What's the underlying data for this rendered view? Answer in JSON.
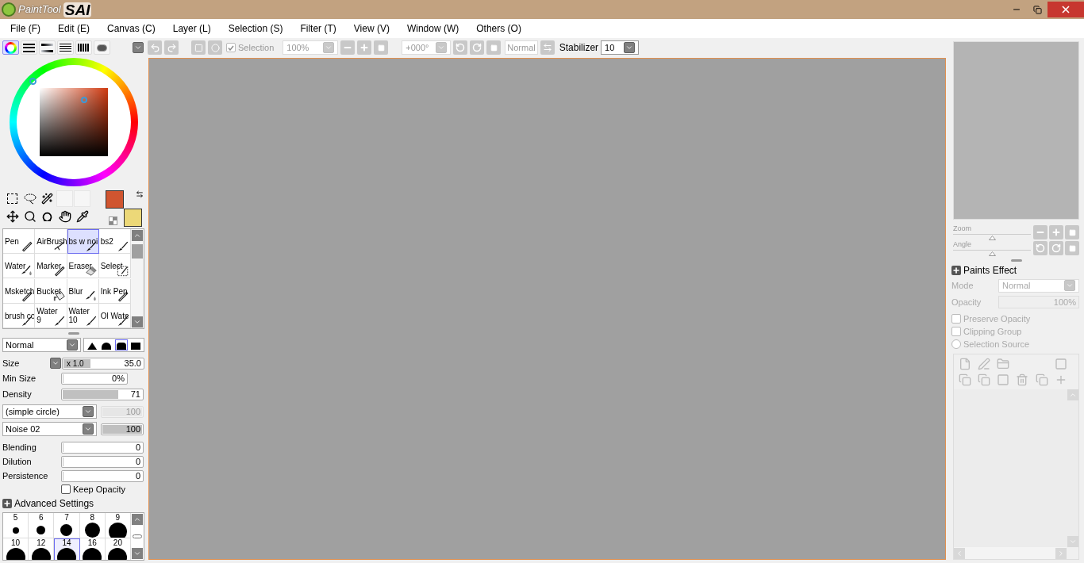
{
  "title_bar": {
    "logo_small": "PaintTool",
    "logo_large": "SAI"
  },
  "menu": [
    "File (F)",
    "Edit (E)",
    "Canvas (C)",
    "Layer (L)",
    "Selection (S)",
    "Filter (T)",
    "View (V)",
    "Window (W)",
    "Others (O)"
  ],
  "color_tabs": [
    {
      "kind": "wheel",
      "selected": true
    },
    {
      "kind": "rgb",
      "selected": false
    },
    {
      "kind": "hsv",
      "selected": false
    },
    {
      "kind": "palette",
      "selected": false
    },
    {
      "kind": "grid",
      "selected": false
    },
    {
      "kind": "scratch",
      "selected": false
    }
  ],
  "toolbar": {
    "selection": {
      "label": "Selection",
      "checked": true
    },
    "zoom": "100%",
    "angle": "+000°",
    "blend": "Normal",
    "stabilizer_label": "Stabilizer",
    "stabilizer": "10"
  },
  "tools": [
    {
      "label": "Pen",
      "kind": "pen",
      "selected": false
    },
    {
      "label": "AirBrush",
      "kind": "airbrush",
      "selected": false
    },
    {
      "label": "bs w noi",
      "kind": "brush",
      "selected": true
    },
    {
      "label": "bs2",
      "kind": "brush",
      "selected": false
    },
    {
      "label": "Water",
      "kind": "water",
      "selected": false
    },
    {
      "label": "Marker",
      "kind": "pen",
      "selected": false
    },
    {
      "label": "Eraser",
      "kind": "eraser",
      "selected": false
    },
    {
      "label": "Select",
      "kind": "select",
      "selected": false
    },
    {
      "label": "Msketch",
      "kind": "pen",
      "selected": false
    },
    {
      "label": "Bucket",
      "kind": "bucket",
      "selected": false
    },
    {
      "label": "Blur",
      "kind": "water",
      "selected": false
    },
    {
      "label": "Ink Pen",
      "kind": "pen",
      "selected": false
    },
    {
      "label": "brush co",
      "kind": "brush",
      "selected": false
    },
    {
      "label": "Water",
      "sub": "9",
      "kind": "brush",
      "selected": false
    },
    {
      "label": "Water",
      "sub": "10",
      "kind": "brush",
      "selected": false
    },
    {
      "label": "Ol Wate",
      "kind": "brush",
      "selected": false
    }
  ],
  "brush": {
    "blend_mode": "Normal",
    "edge_shapes": [
      {
        "selected": false
      },
      {
        "selected": false
      },
      {
        "selected": true
      },
      {
        "selected": false
      }
    ],
    "size": {
      "label": "Size",
      "multiplier": "x 1.0",
      "value": "35.0",
      "level": 0.35
    },
    "min_size": {
      "label": "Min Size",
      "value": "0%",
      "level": 0
    },
    "density": {
      "label": "Density",
      "value": "71",
      "level": 0.71
    },
    "shape": {
      "name": "(simple circle)",
      "value": "100",
      "disabled": true,
      "level": 1
    },
    "texture": {
      "name": "Noise 02",
      "value": "100",
      "disabled": false,
      "level": 1
    },
    "mixing": [
      {
        "label": "Blending",
        "value": "0",
        "level": 0
      },
      {
        "label": "Dilution",
        "value": "0",
        "level": 0
      },
      {
        "label": "Persistence",
        "value": "0",
        "level": 0
      }
    ],
    "keep_opacity": {
      "label": "Keep Opacity",
      "checked": false
    },
    "advanced": "Advanced Settings"
  },
  "brush_sizes": [
    {
      "label": "5",
      "selected": false
    },
    {
      "label": "6",
      "selected": false
    },
    {
      "label": "7",
      "selected": false
    },
    {
      "label": "8",
      "selected": false
    },
    {
      "label": "9",
      "selected": false
    },
    {
      "label": "10",
      "selected": false
    },
    {
      "label": "12",
      "selected": false
    },
    {
      "label": "14",
      "selected": true
    },
    {
      "label": "16",
      "selected": false
    },
    {
      "label": "20",
      "selected": false
    }
  ],
  "navigator": {
    "zoom": {
      "label": "Zoom",
      "level": 0.5
    },
    "angle": {
      "label": "Angle",
      "level": 0.5
    }
  },
  "layer_panel": {
    "title": "Paints Effect",
    "mode_label": "Mode",
    "mode": "Normal",
    "opacity_label": "Opacity",
    "opacity": {
      "value": "100%",
      "level": 1
    },
    "options": [
      {
        "label": "Preserve Opacity",
        "kind": "checkbox",
        "checked": false
      },
      {
        "label": "Clipping Group",
        "kind": "checkbox",
        "checked": false
      },
      {
        "label": "Selection Source",
        "kind": "radio",
        "checked": false
      }
    ]
  }
}
